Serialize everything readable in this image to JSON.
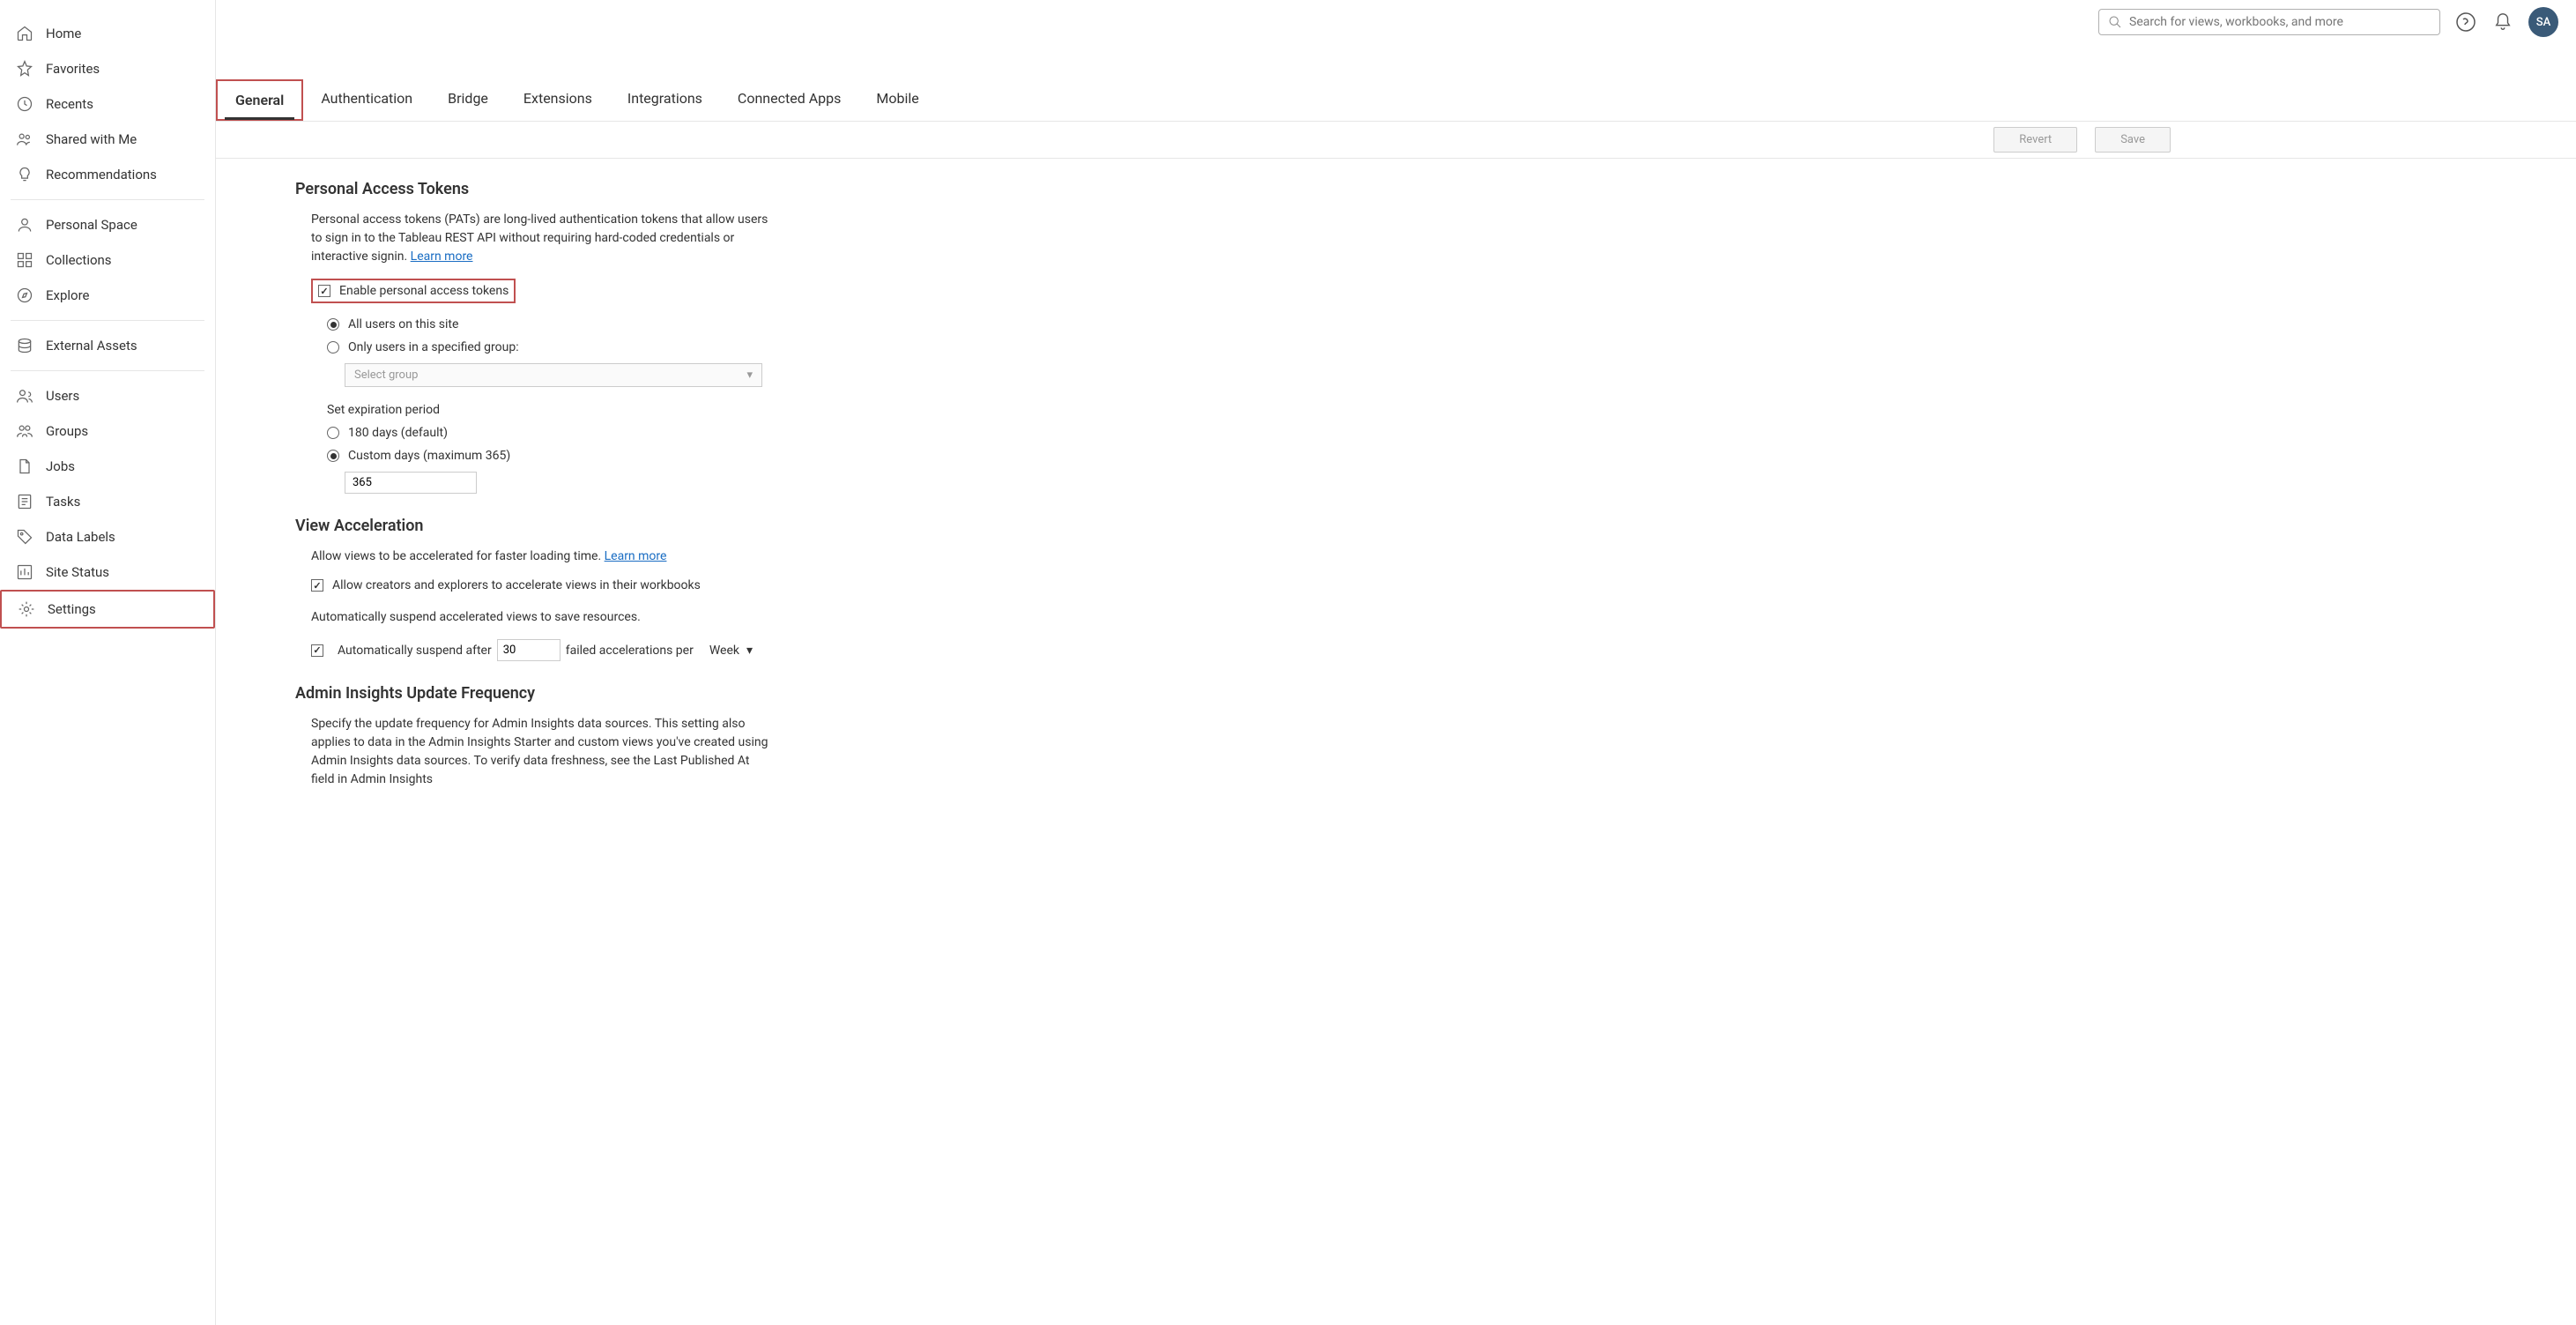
{
  "topbar": {
    "search_placeholder": "Search for views, workbooks, and more",
    "avatar_initials": "SA"
  },
  "sidebar": {
    "items": [
      {
        "label": "Home"
      },
      {
        "label": "Favorites"
      },
      {
        "label": "Recents"
      },
      {
        "label": "Shared with Me"
      },
      {
        "label": "Recommendations"
      },
      {
        "label": "Personal Space"
      },
      {
        "label": "Collections"
      },
      {
        "label": "Explore"
      },
      {
        "label": "External Assets"
      },
      {
        "label": "Users"
      },
      {
        "label": "Groups"
      },
      {
        "label": "Jobs"
      },
      {
        "label": "Tasks"
      },
      {
        "label": "Data Labels"
      },
      {
        "label": "Site Status"
      },
      {
        "label": "Settings"
      }
    ]
  },
  "tabs": [
    {
      "label": "General"
    },
    {
      "label": "Authentication"
    },
    {
      "label": "Bridge"
    },
    {
      "label": "Extensions"
    },
    {
      "label": "Integrations"
    },
    {
      "label": "Connected Apps"
    },
    {
      "label": "Mobile"
    }
  ],
  "actions": {
    "revert": "Revert",
    "save": "Save"
  },
  "pat": {
    "heading": "Personal Access Tokens",
    "desc": "Personal access tokens (PATs) are long-lived authentication tokens that allow users to sign in to the Tableau REST API without requiring hard-coded credentials or interactive signin.  ",
    "learn_more": "Learn more",
    "enable_label": "Enable personal access tokens",
    "radio_all": "All users on this site",
    "radio_group": "Only users in a specified group:",
    "select_placeholder": "Select group",
    "expiration_label": "Set expiration period",
    "radio_180": "180 days (default)",
    "radio_custom": "Custom days (maximum 365)",
    "custom_value": "365"
  },
  "va": {
    "heading": "View Acceleration",
    "desc": "Allow views to be accelerated for faster loading time. ",
    "learn_more": "Learn more",
    "check1": "Allow creators and explorers to accelerate views in their workbooks",
    "suspend_desc": "Automatically suspend accelerated views to save resources.",
    "check2_pre": "Automatically suspend after",
    "check2_value": "30",
    "check2_post": "failed accelerations per",
    "period": "Week"
  },
  "admin": {
    "heading": "Admin Insights Update Frequency",
    "desc": "Specify the update frequency for Admin Insights data sources. This setting also applies to data in the Admin Insights Starter and custom views you've created using Admin Insights data sources. To verify data freshness, see the Last Published At field in Admin Insights"
  }
}
